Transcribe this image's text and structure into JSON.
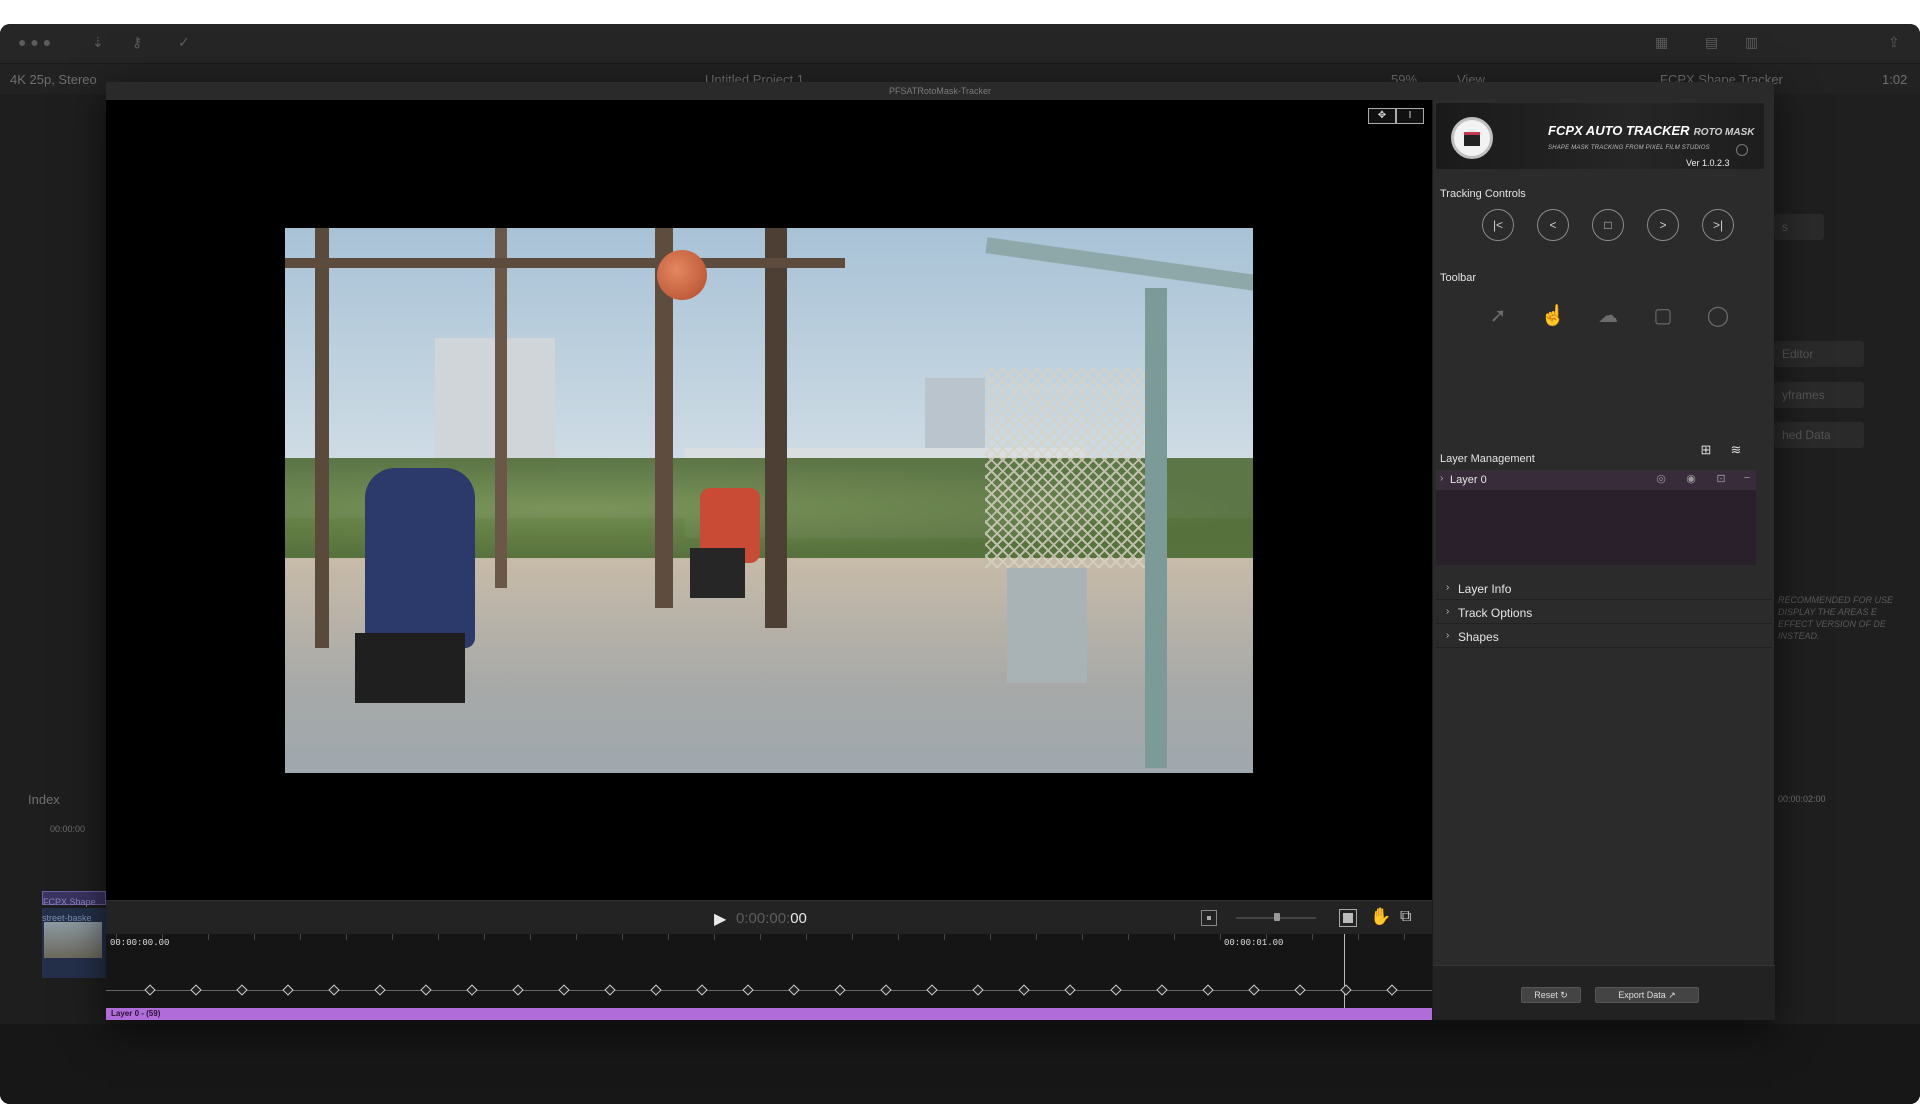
{
  "host": {
    "format": "4K 25p, Stereo",
    "project_title": "Untitled Project 1",
    "zoom": "59%",
    "view_menu": "View",
    "inspector_title": "FCPX Shape Tracker",
    "duration": "1:02",
    "index_tab": "Index",
    "index_timecode": "00:00:00",
    "clip_label_shape": "FCPX Shape",
    "clip_label_basket": "street-baske",
    "inspector_fields": [
      "s",
      "Editor",
      "yframes",
      "hed Data"
    ],
    "inspector_note": "RECOMMENDED FOR USE DISPLAY THE AREAS E EFFECT VERSION OF DE INSTEAD.",
    "right_timecode": "00:00:02:00"
  },
  "plugin": {
    "window_title": "PFSATRotoMask-Tracker"
  },
  "transport": {
    "timecode_dim": "0:00:00:",
    "timecode_bright": "00"
  },
  "timeline": {
    "start_time": "00:00:00.00",
    "marker_time": "00:00:01.00",
    "layer_bar_label": "Layer 0 - (59)"
  },
  "panel": {
    "banner_title": "FCPX AUTO TRACKER",
    "banner_title_b": "ROTO MASK",
    "banner_sub": "SHAPE MASK TRACKING FROM PIXEL FILM STUDIOS",
    "version": "Ver 1.0.2.3",
    "tracking_controls_label": "Tracking Controls",
    "toolbar_label": "Toolbar",
    "layer_management_label": "Layer Management",
    "layer_name": "Layer 0",
    "sections": [
      "Layer Info",
      "Track Options",
      "Shapes"
    ],
    "reset_label": "Reset",
    "export_label": "Export Data"
  },
  "colors": {
    "layer_bar": "#b06cd8",
    "layer_row": "#382c3b",
    "panel_bg": "#2b2b2b"
  },
  "icons": {
    "tracking": [
      "skip-to-start-icon",
      "step-back-icon",
      "stop-icon",
      "step-forward-icon",
      "skip-to-end-icon"
    ],
    "toolbar": [
      "pointer-icon",
      "hand-select-icon",
      "freehand-shape-icon",
      "rectangle-icon",
      "ellipse-icon"
    ]
  }
}
